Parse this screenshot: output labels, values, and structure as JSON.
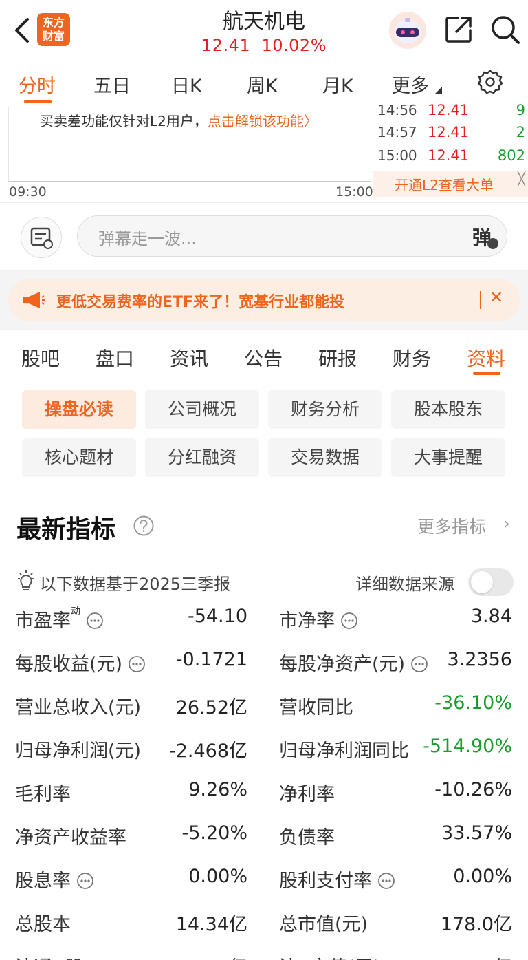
{
  "header": {
    "logo_text_line1": "东方",
    "logo_text_line2": "财富",
    "stock_name": "航天机电",
    "price": "12.41",
    "change_pct": "10.02%"
  },
  "period_tabs": [
    "分时",
    "五日",
    "日K",
    "周K",
    "月K",
    "更多"
  ],
  "chart": {
    "notice": "买卖差功能仅针对L2用户，",
    "notice_link": "点击解锁该功能〉",
    "time_start": "09:30",
    "time_end": "15:00"
  },
  "ticks": [
    {
      "time": "14:56",
      "price": "12.41",
      "volume": "9",
      "color": "green"
    },
    {
      "time": "14:57",
      "price": "12.41",
      "volume": "2",
      "color": "green"
    },
    {
      "time": "15:00",
      "price": "12.41",
      "volume": "802",
      "color": "green"
    }
  ],
  "open_l2": {
    "label": "开通L2查看大单",
    "close": "╳"
  },
  "danmu": {
    "placeholder": "弹幕走一波...",
    "toggle_label": "弹"
  },
  "promo": {
    "text": "更低交易费率的ETF来了！宽基行业都能投",
    "close": "✕"
  },
  "section_tabs": [
    "股吧",
    "盘口",
    "资讯",
    "公告",
    "研报",
    "财务",
    "资料"
  ],
  "sub_tabs": [
    "操盘必读",
    "公司概况",
    "财务分析",
    "股本股东",
    "核心题材",
    "分红融资",
    "交易数据",
    "大事提醒"
  ],
  "indicators": {
    "title": "最新指标",
    "more_label": "更多指标",
    "more_chevron": "›",
    "basis": "以下数据基于2025三季报",
    "source_label": "详细数据来源",
    "source_toggle_on": false
  },
  "colors": {
    "accent": "#f0641e",
    "up": "#e02020",
    "down": "#1a9c2b"
  },
  "chart_data": {
    "type": "table",
    "columns": [
      "指标",
      "数值"
    ],
    "rows": [
      {
        "label": "市盈率",
        "sup": "动",
        "value": "-54.10",
        "info": true
      },
      {
        "label": "市净率",
        "sup": "",
        "value": "3.84",
        "info": true
      },
      {
        "label": "每股收益(元)",
        "sup": "",
        "value": "-0.1721",
        "info": true
      },
      {
        "label": "每股净资产(元)",
        "sup": "",
        "value": "3.2356",
        "info": true
      },
      {
        "label": "营业总收入(元)",
        "sup": "",
        "value": "26.52亿",
        "info": false
      },
      {
        "label": "营收同比",
        "sup": "",
        "value": "-36.10%",
        "info": false,
        "color": "green"
      },
      {
        "label": "归母净利润(元)",
        "sup": "",
        "value": "-2.468亿",
        "info": false
      },
      {
        "label": "归母净利润同比",
        "sup": "",
        "value": "-514.90%",
        "info": false,
        "color": "green"
      },
      {
        "label": "毛利率",
        "sup": "",
        "value": "9.26%",
        "info": false
      },
      {
        "label": "净利率",
        "sup": "",
        "value": "-10.26%",
        "info": false
      },
      {
        "label": "净资产收益率",
        "sup": "",
        "value": "-5.20%",
        "info": false
      },
      {
        "label": "负债率",
        "sup": "",
        "value": "33.57%",
        "info": false
      },
      {
        "label": "股息率",
        "sup": "",
        "value": "0.00%",
        "info": true
      },
      {
        "label": "股利支付率",
        "sup": "",
        "value": "0.00%",
        "info": true
      },
      {
        "label": "总股本",
        "sup": "",
        "value": "14.34亿",
        "info": false
      },
      {
        "label": "总市值(元)",
        "sup": "",
        "value": "178.0亿",
        "info": false
      },
      {
        "label": "流通A股",
        "sup": "",
        "value": "14.34亿",
        "info": false
      },
      {
        "label": "流A市值(元)",
        "sup": "",
        "value": "178.0亿",
        "info": false
      }
    ]
  }
}
